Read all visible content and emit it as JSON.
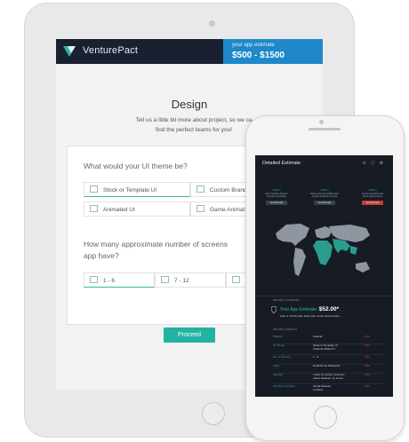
{
  "header": {
    "brand": "VenturePact",
    "estimate_label": "your app estimate",
    "estimate_value": "$500 - $1500"
  },
  "page": {
    "title": "Design",
    "subtitle_line1": "Tell us a little bit more about project, so we ca",
    "subtitle_line2": "find the perfect teams for you!"
  },
  "ui_theme": {
    "question": "What would your UI theme be?",
    "options": [
      "Stock or Template UI",
      "Custom Brand",
      "Animated UI",
      "Game Animat"
    ]
  },
  "screens": {
    "question_line1": "How many approximate number of screens",
    "question_line2": "app have?",
    "options": [
      "1 - 6",
      "7 - 12",
      ""
    ]
  },
  "proceed_label": "Proceed",
  "phone": {
    "title": "Detailed Estimate",
    "zones": [
      {
        "name": "ZONE 1",
        "desc_line1": "USA Canada, Western",
        "desc_line2": "Europe & Australia",
        "badge": "Get Estimate"
      },
      {
        "name": "ZONE 2",
        "desc_line1": "Eastern Europe Middle East",
        "desc_line2": "Central & South America",
        "badge": "Get Estimate"
      },
      {
        "name": "ZONE 3",
        "desc_line1": "South Asia East Asia",
        "desc_line2": "South Asia & Africa",
        "badge": "Get Estimate"
      }
    ],
    "summary_label": "PROJECT SUMMARY",
    "estimate_label": "Your App Estimate:",
    "estimate_value": "$52.00*",
    "zone_line": "Zone 3: South Asia, East Asia, South Asia & Africa",
    "details_label": "PROJECT DETAILS",
    "rows": [
      {
        "key": "Platform",
        "value": "Android",
        "price": "+$$$"
      },
      {
        "key": "UI Theme",
        "value": "Stock or Template UI",
        "value2": "Custome Brand UI",
        "price": "+$$$"
      },
      {
        "key": "No. of Screens",
        "value": "1 - 6",
        "price": "+$$$"
      },
      {
        "key": "Login",
        "value": "Email ID via Password",
        "price": "+$$$"
      },
      {
        "key": "Security",
        "value": "I want to encrypt communi-",
        "value2": "cation between my server",
        "price": "+$$$"
      },
      {
        "key": "3rd Party Services",
        "value": "Social Network",
        "value2": "Location",
        "price": "+$$$"
      }
    ]
  },
  "colors": {
    "accent": "#22b3a3",
    "navy": "#1a2030",
    "estimate_blue": "#1e88c8"
  }
}
